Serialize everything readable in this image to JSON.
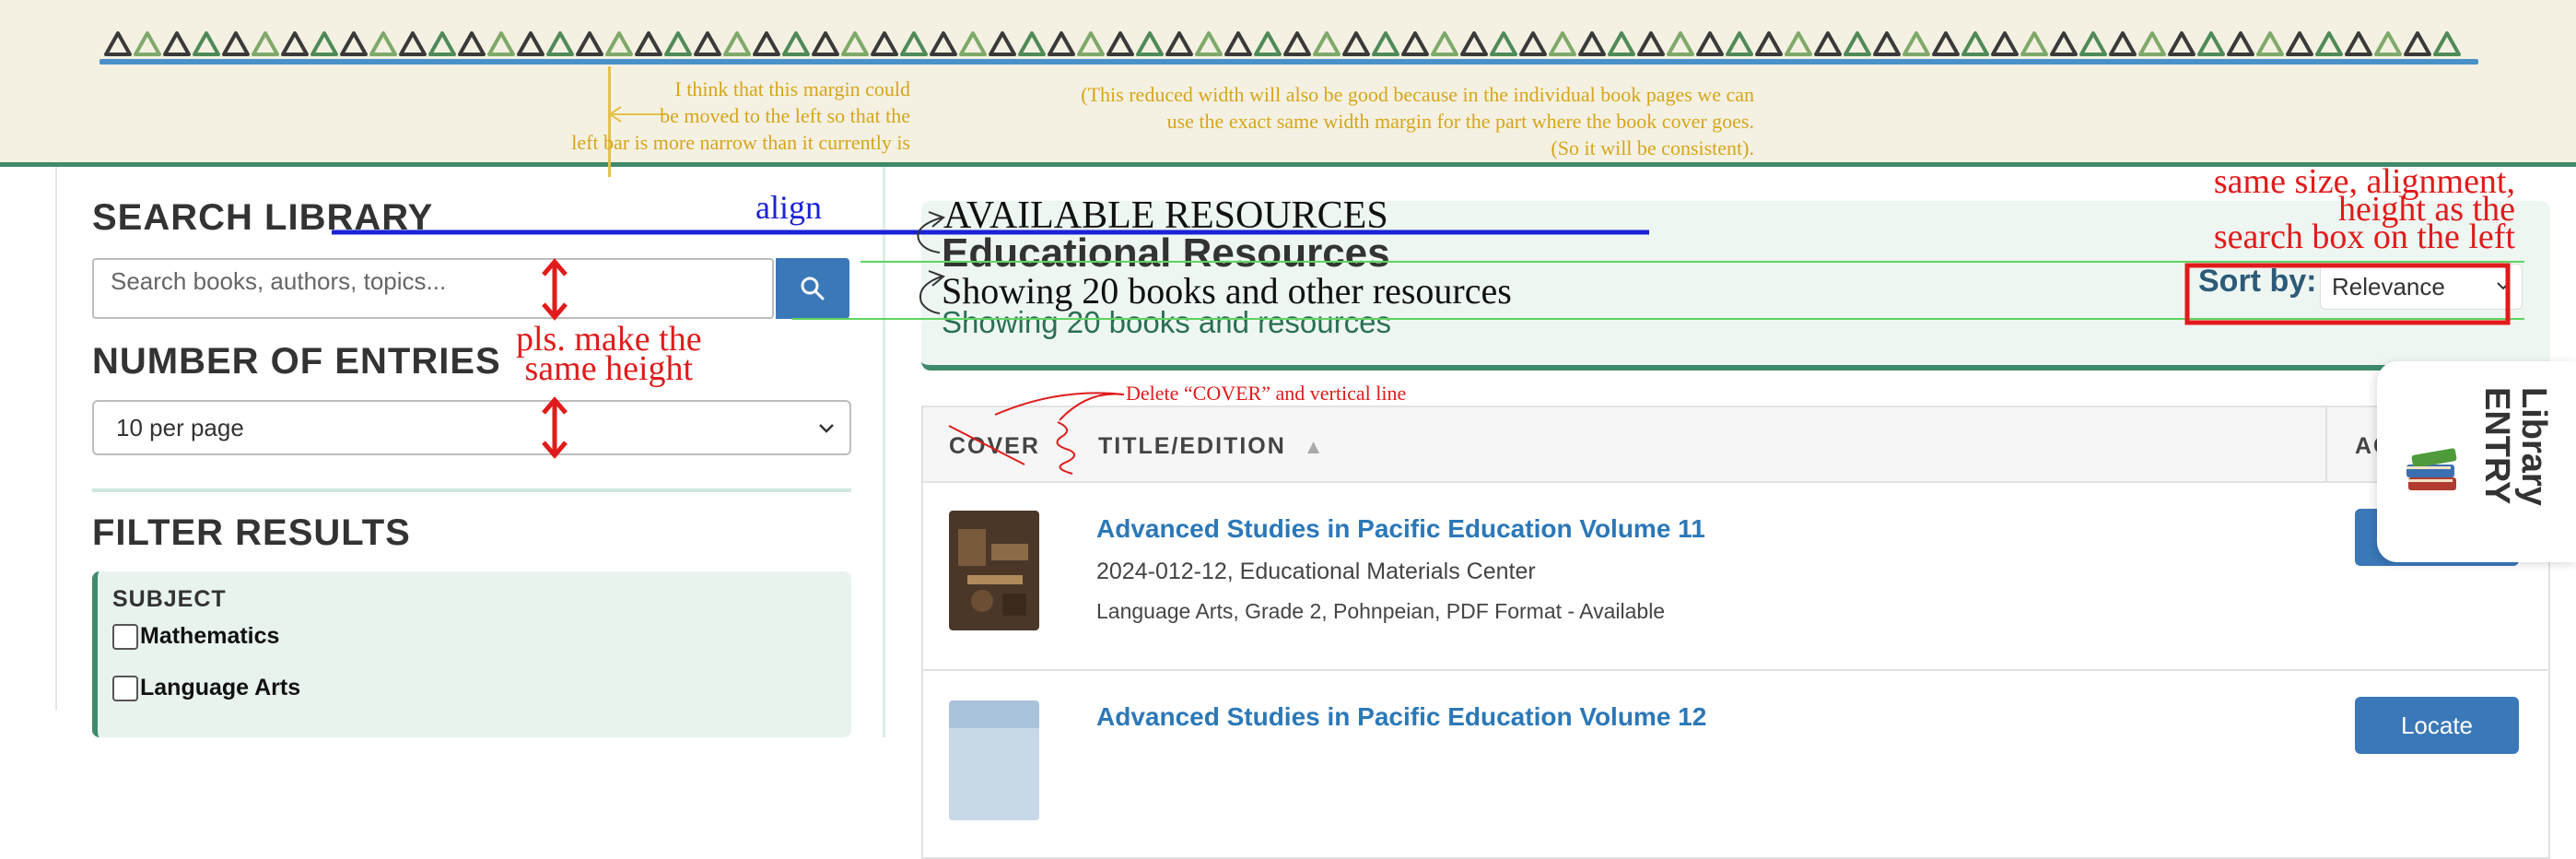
{
  "annotations": {
    "margin_note": [
      "I think that this margin could",
      "be moved to the left so that the",
      "left bar is more narrow than it currently is"
    ],
    "width_note": [
      "(This reduced width will also be good because in the individual book pages we can",
      "use the exact same width margin for the part where the book cover goes.",
      "(So it will be consistent)."
    ],
    "align": "align",
    "same_height": [
      "pls. make the",
      "same height"
    ],
    "same_size": [
      "same size, alignment,",
      "height as the",
      "search box on the left"
    ],
    "delete_cover": "Delete “COVER” and vertical line",
    "available_resources_alt": "AVAILABLE RESOURCES",
    "showing_alt": "Showing 20 books and other resources"
  },
  "sidebar": {
    "search_heading": "SEARCH LIBRARY",
    "search_placeholder": "Search books, authors, topics...",
    "entries_heading": "NUMBER OF ENTRIES",
    "entries_value": "10 per page",
    "filter_heading": "FILTER RESULTS",
    "subject_label": "SUBJECT",
    "subjects": [
      "Mathematics",
      "Language Arts"
    ]
  },
  "main": {
    "title": "Educational Resources",
    "subtitle": "Showing 20 books and resources",
    "sort_label": "Sort by:",
    "sort_value": "Relevance",
    "columns": {
      "cover": "COVER",
      "title": "TITLE/EDITION",
      "sort_arrow": "▲",
      "actions": "ACTIONS"
    },
    "rows": [
      {
        "title": "Advanced Studies in Pacific Education Volume 11",
        "meta": "2024-012-12, Educational Materials Center",
        "tags": "Language Arts, Grade 2, Pohnpeian, PDF Format - Available",
        "action": "Locate"
      },
      {
        "title": "Advanced Studies in Pacific Education Volume 12",
        "meta": "",
        "tags": "",
        "action": "Locate"
      }
    ]
  },
  "library_tab": {
    "line1": "Library",
    "line2": "ENTRY"
  },
  "colors": {
    "accent_green": "#3f8a6c",
    "link_blue": "#2b78b8",
    "button_blue": "#3a78b8",
    "banner_bg": "#f4f1e2",
    "annotation_red": "#e01b1b",
    "annotation_blue": "#1a22d6",
    "annotation_yellow": "#d6a51a"
  }
}
